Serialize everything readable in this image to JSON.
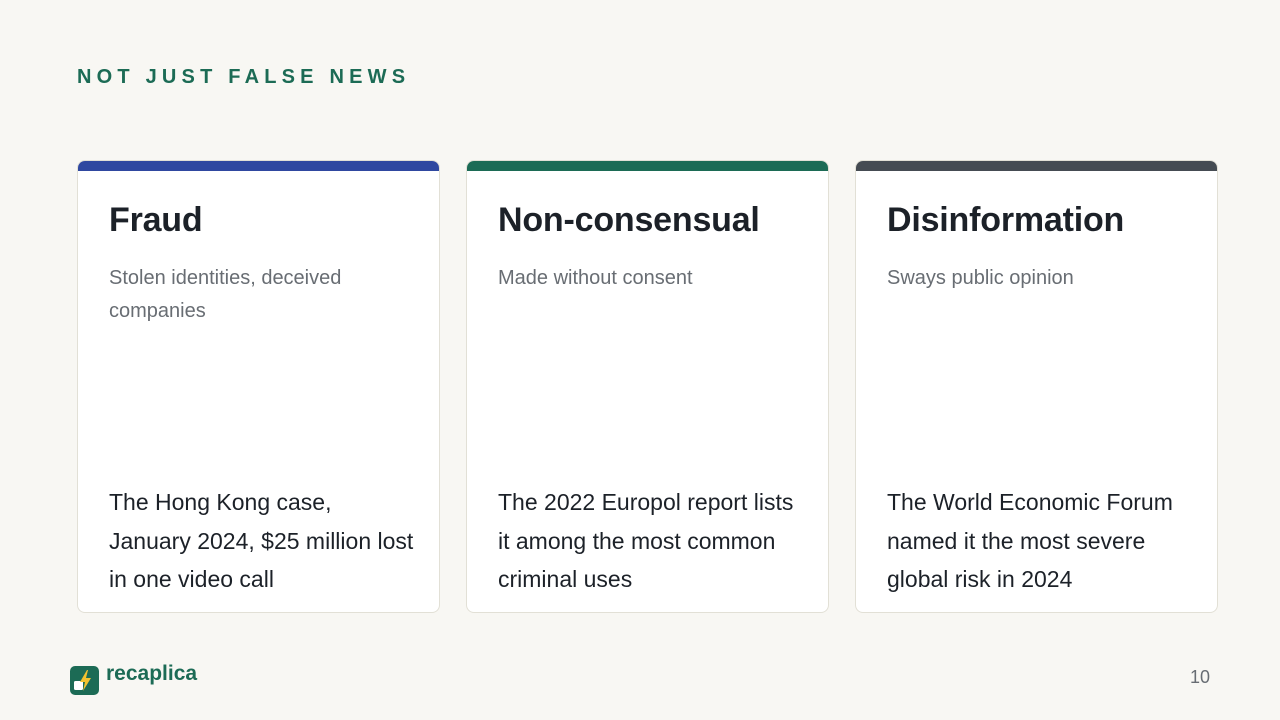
{
  "eyebrow": "NOT JUST FALSE NEWS",
  "cards": [
    {
      "title": "Fraud",
      "subtitle": "Stolen identities, deceived companies",
      "body": "The Hong Kong case, January 2024, $25 million lost in one video call",
      "accent_color": "#2f48a0"
    },
    {
      "title": "Non-consensual",
      "subtitle": "Made without consent",
      "body": "The 2022 Europol report lists it among the most common criminal uses",
      "accent_color": "#1c6b55"
    },
    {
      "title": "Disinformation",
      "subtitle": "Sways public opinion",
      "body": "The World Economic Forum named it the most severe global risk in 2024",
      "accent_color": "#454b52"
    }
  ],
  "footer": {
    "brand": "recaplica",
    "logo_icon": "lightning-bolt-icon",
    "page_number": "10"
  },
  "colors": {
    "background": "#f8f7f3",
    "brand_green": "#1c6b55",
    "text_dark": "#1c2128",
    "text_muted": "#686d73"
  }
}
